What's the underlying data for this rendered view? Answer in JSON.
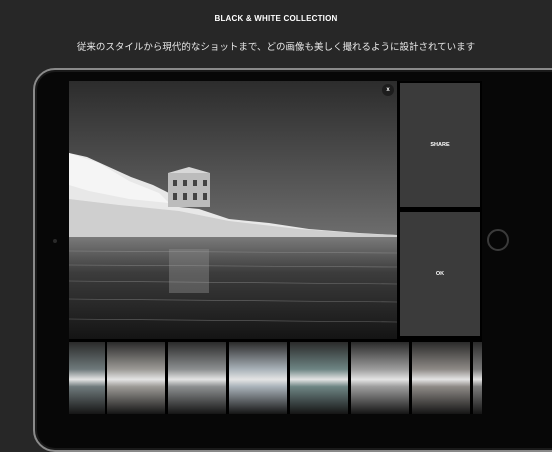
{
  "header": {
    "title": "BLACK & WHITE COLLECTION",
    "subtitle": "従来のスタイルから現代的なショットまで、どの画像も美しく撮れるように設計されています"
  },
  "editor": {
    "close_label": "x",
    "share_label": "SHARE",
    "ok_label": "OK"
  },
  "filters": [
    {
      "tone": "#6f7a7c"
    },
    {
      "tone": "#9c9a96"
    },
    {
      "tone": "#8c8f90"
    },
    {
      "tone": "#a9b2b9"
    },
    {
      "tone": "#6e8584"
    },
    {
      "tone": "#9d9d9d"
    },
    {
      "tone": "#8e8a86"
    },
    {
      "tone": "#7a7a7a"
    }
  ],
  "icons": [
    "close-icon",
    "home-button",
    "camera"
  ]
}
